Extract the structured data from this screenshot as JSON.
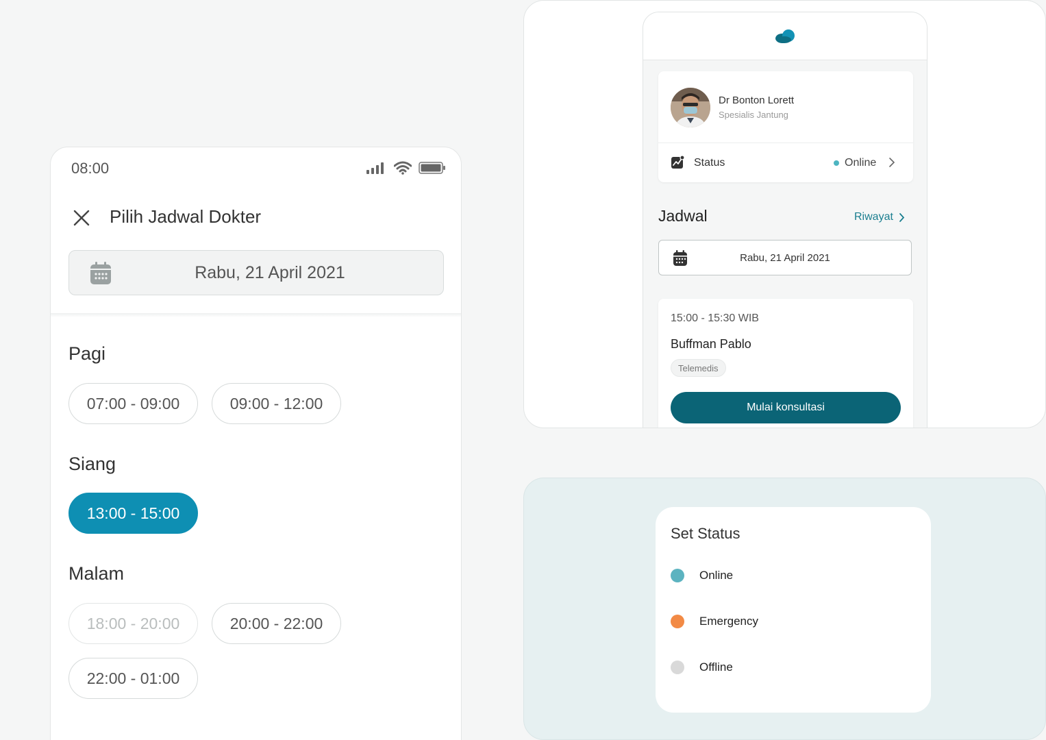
{
  "schedule_screen": {
    "status_bar": {
      "time": "08:00"
    },
    "title": "Pilih Jadwal Dokter",
    "date": "Rabu, 21 April 2021",
    "sections": {
      "pagi": {
        "label": "Pagi",
        "slots": [
          "07:00 - 09:00",
          "09:00 - 12:00"
        ]
      },
      "siang": {
        "label": "Siang",
        "slots": [
          "13:00 - 15:00"
        ],
        "selected": "13:00 - 15:00"
      },
      "malam": {
        "label": "Malam",
        "slots": [
          "18:00 - 20:00",
          "20:00 - 22:00",
          "22:00 - 01:00"
        ],
        "disabled": "18:00 - 20:00"
      }
    },
    "colors": {
      "selected": "#0e8fb3"
    }
  },
  "doctor_screen": {
    "doctor": {
      "name": "Dr Bonton Lorett",
      "specialty": "Spesialis Jantung"
    },
    "status": {
      "label": "Status",
      "value": "Online",
      "dot_color": "#4db5c1"
    },
    "schedule": {
      "title": "Jadwal",
      "history_link": "Riwayat",
      "date": "Rabu, 21 April 2021"
    },
    "appointment": {
      "time": "15:00 - 15:30 WIB",
      "patient": "Buffman Pablo",
      "type": "Telemedis",
      "action": "Mulai konsultasi"
    },
    "colors": {
      "primary": "#0b6476",
      "link": "#1a7e8f"
    }
  },
  "status_sheet": {
    "title": "Set Status",
    "options": [
      {
        "label": "Online",
        "color": "#5cb3c0"
      },
      {
        "label": "Emergency",
        "color": "#f28a45"
      },
      {
        "label": "Offline",
        "color": "#d9d9d9"
      }
    ]
  }
}
